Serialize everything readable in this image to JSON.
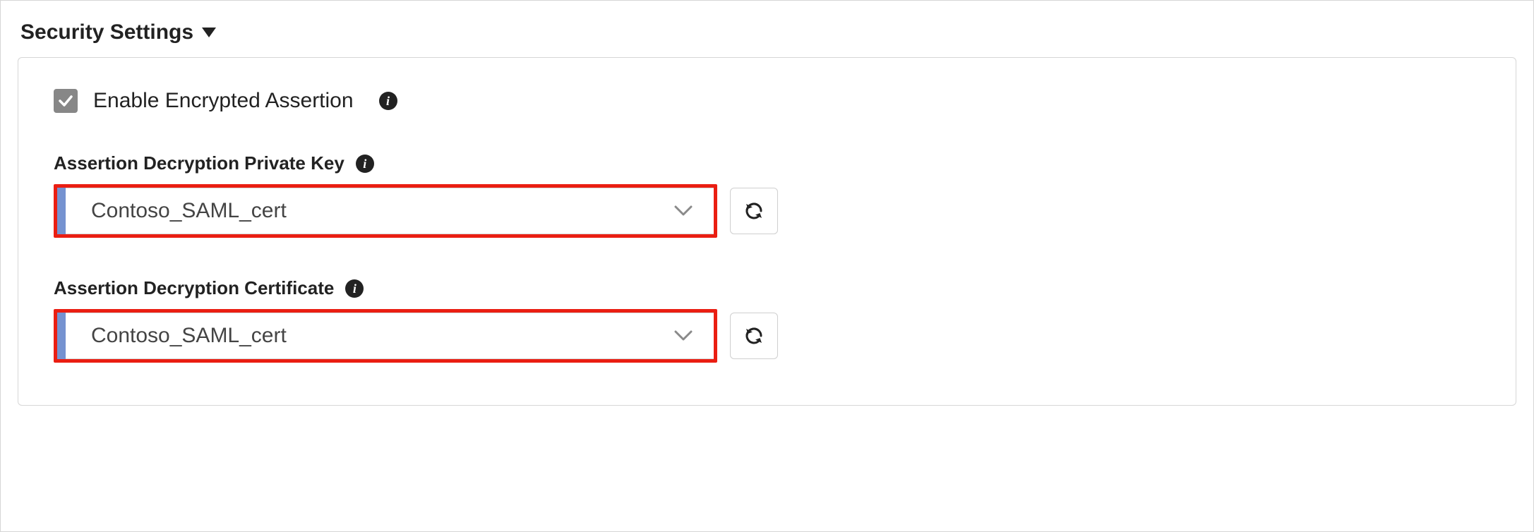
{
  "section": {
    "title": "Security Settings"
  },
  "checkbox": {
    "checked": true,
    "label": "Enable Encrypted Assertion"
  },
  "fields": {
    "privateKey": {
      "label": "Assertion Decryption Private Key",
      "value": "Contoso_SAML_cert"
    },
    "certificate": {
      "label": "Assertion Decryption Certificate",
      "value": "Contoso_SAML_cert"
    }
  },
  "colors": {
    "highlight": "#ea1e12",
    "accent": "#7592d0",
    "checkbox_bg": "#878787"
  }
}
